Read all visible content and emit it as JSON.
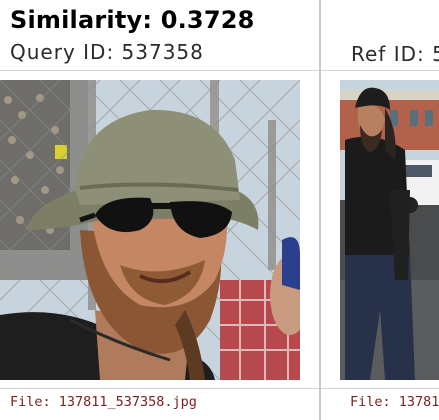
{
  "query": {
    "similarity_text": "Similarity: 0.3728",
    "id_text": "Query ID: 537358",
    "file_text": "File: 137811_537358.jpg"
  },
  "reference": {
    "id_text": "Ref ID: 5",
    "file_text": "File: 13781"
  },
  "colors": {
    "file_text": "#7a2420",
    "divider": "#c9c9c9"
  }
}
